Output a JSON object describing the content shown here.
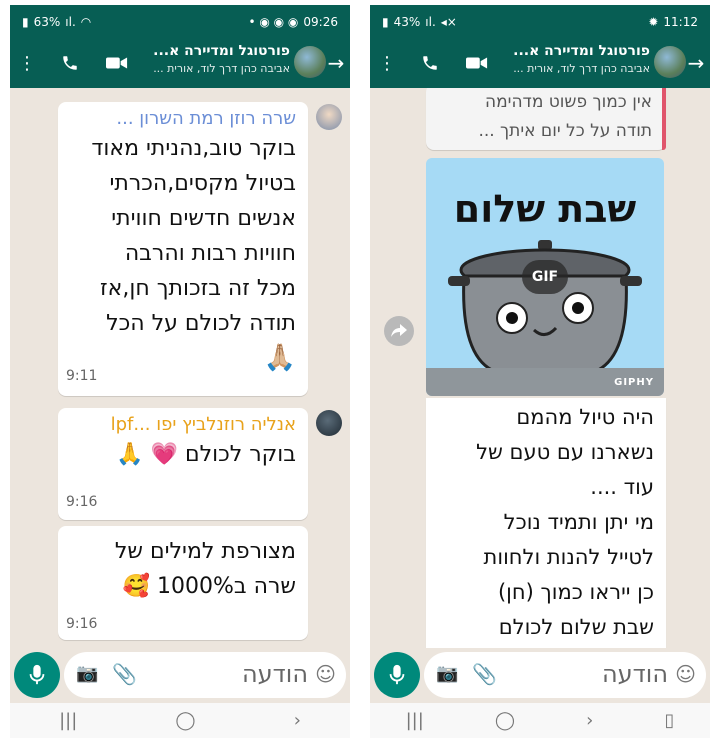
{
  "left": {
    "status": {
      "battery": "63%",
      "time": "09:26"
    },
    "header": {
      "title": "פורטוגל ומדיירה א...",
      "subtitle": "אביבה כהן דרך לוד, אורית ..."
    },
    "messages": [
      {
        "sender": "שרה רוזן רמת השרון ...",
        "lines": [
          "בוקר טוב,נהניתי מאוד",
          "בטיול מקסים,הכרתי",
          "אנשים חדשים חוויתי",
          "חוויות רבות והרבה",
          "מכל זה בזכותך חן,אז",
          "תודה לכולם על הכל"
        ],
        "emoji": "🙏🏼",
        "time": "9:11"
      },
      {
        "sender": "אנליה רוזנלביץ יפו ...lpf",
        "lines": [
          "בוקר לכולם 💗 🙏"
        ],
        "time": "9:16"
      },
      {
        "lines": [
          "מצורפת למילים של",
          "שרה ב1000% 🥰"
        ],
        "time": "9:16"
      }
    ],
    "input": {
      "placeholder": "הודעה"
    }
  },
  "right": {
    "status": {
      "battery": "43%",
      "time": "11:12"
    },
    "header": {
      "title": "פורטוגל ומדיירה א...",
      "subtitle": "אביבה כהן דרך לוד, אורית ..."
    },
    "quote": {
      "lines": [
        "אין כמוך פשוט מדהימה",
        "תודה על כל יום איתך ..."
      ]
    },
    "gif": {
      "text": "שבת שלום",
      "badge": "GIF",
      "source": "GIPHY"
    },
    "message": {
      "lines": [
        "היה טיול מהמם",
        "נשארנו עם טעם של",
        "עוד ....",
        "מי יתן ותמיד נוכל",
        "לטייל  להנות ולחוות",
        "כן ייראו כמוך (חן)",
        "שבת שלום לכולם"
      ]
    },
    "input": {
      "placeholder": "הודעה"
    }
  },
  "colors": {
    "header": "#075e54",
    "accent": "#00897b",
    "sender1": "#6b8ed6",
    "sender2": "#e8a21b"
  }
}
